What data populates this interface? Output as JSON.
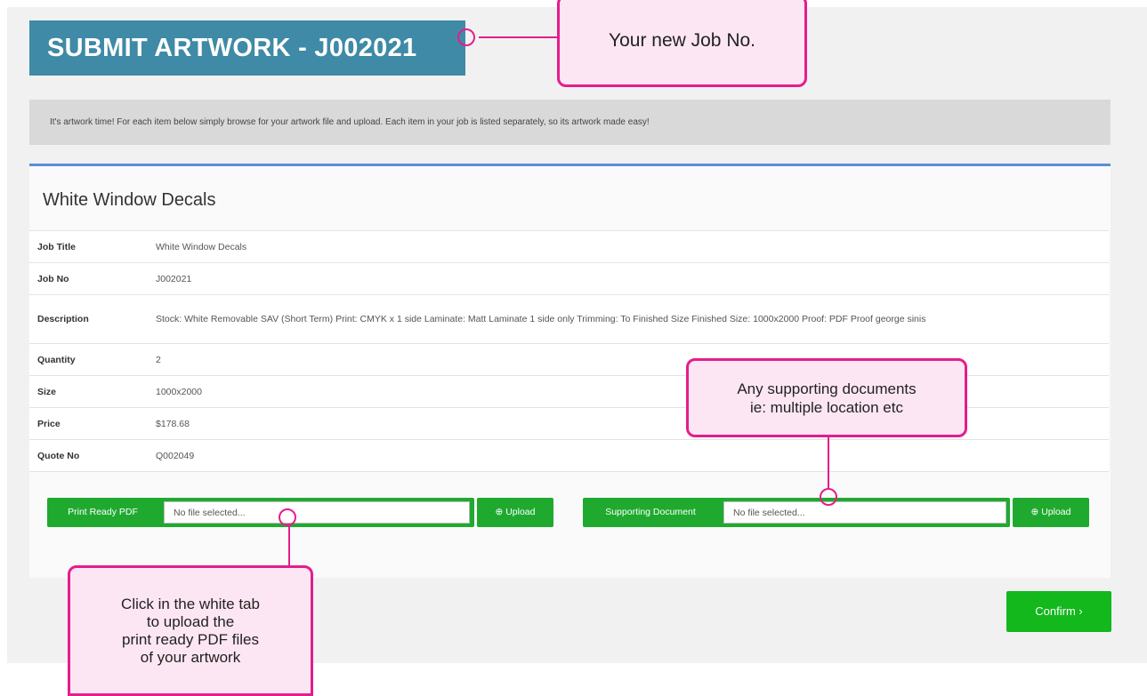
{
  "header": {
    "title": "SUBMIT ARTWORK - J002021"
  },
  "intro": {
    "text": "It's artwork time! For each item below simply browse for your artwork file and upload. Each item in your job is listed separately, so its artwork made easy!"
  },
  "item": {
    "title": "White Window Decals",
    "details": [
      {
        "label": "Job Title",
        "value": "White Window Decals"
      },
      {
        "label": "Job No",
        "value": "J002021"
      },
      {
        "label": "Description",
        "value": "Stock: White Removable SAV (Short Term) Print: CMYK x 1 side Laminate: Matt Laminate 1 side only Trimming: To Finished Size Finished Size: 1000x2000 Proof: PDF Proof george sinis"
      },
      {
        "label": "Quantity",
        "value": "2"
      },
      {
        "label": "Size",
        "value": "1000x2000"
      },
      {
        "label": "Price",
        "value": "$178.68"
      },
      {
        "label": "Quote No",
        "value": "Q002049"
      }
    ]
  },
  "uploads": {
    "print_ready": {
      "label": "Print Ready PDF",
      "placeholder": "No file selected...",
      "button": "⊕ Upload"
    },
    "supporting": {
      "label": "Supporting Document",
      "placeholder": "No file selected...",
      "button": "⊕ Upload"
    }
  },
  "confirm": {
    "label": "Confirm ›"
  },
  "callouts": {
    "job_no": "Your new Job No.",
    "supporting": "Any supporting documents\nie: multiple location etc",
    "upload": "Click in the white tab\nto upload the\nprint ready PDF files\nof your artwork"
  },
  "colors": {
    "title_bg": "#3f8aa6",
    "upload_green": "#1faa2f",
    "confirm_green": "#13b81c",
    "callout_border": "#e41d8d",
    "callout_bg": "#fde6f3",
    "card_accent": "#5b8ed8"
  }
}
